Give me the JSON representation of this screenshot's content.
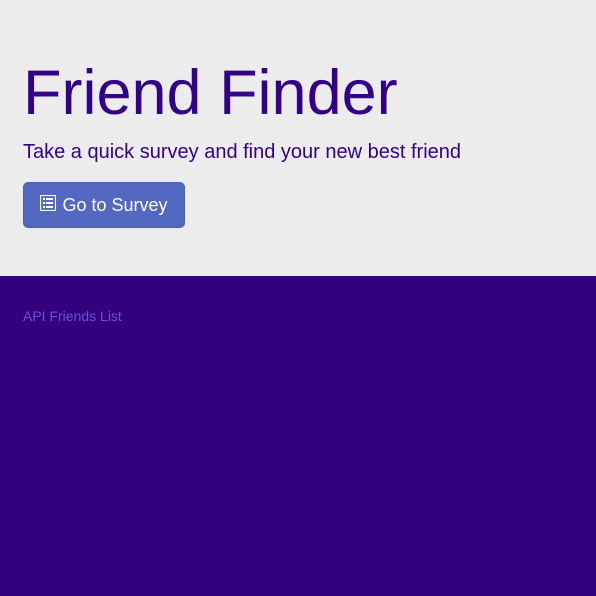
{
  "header": {
    "title": "Friend Finder",
    "tagline": "Take a quick survey and find your new best friend"
  },
  "survey_button": {
    "label": "Go to Survey",
    "icon": "list-icon"
  },
  "footer": {
    "link_label": "API Friends List"
  },
  "colors": {
    "header_background": "#ececec",
    "page_background": "#330080",
    "title_text": "#33008a",
    "button_background": "#5268c1",
    "button_text": "#ffffff",
    "link_text": "#6a55d6"
  }
}
